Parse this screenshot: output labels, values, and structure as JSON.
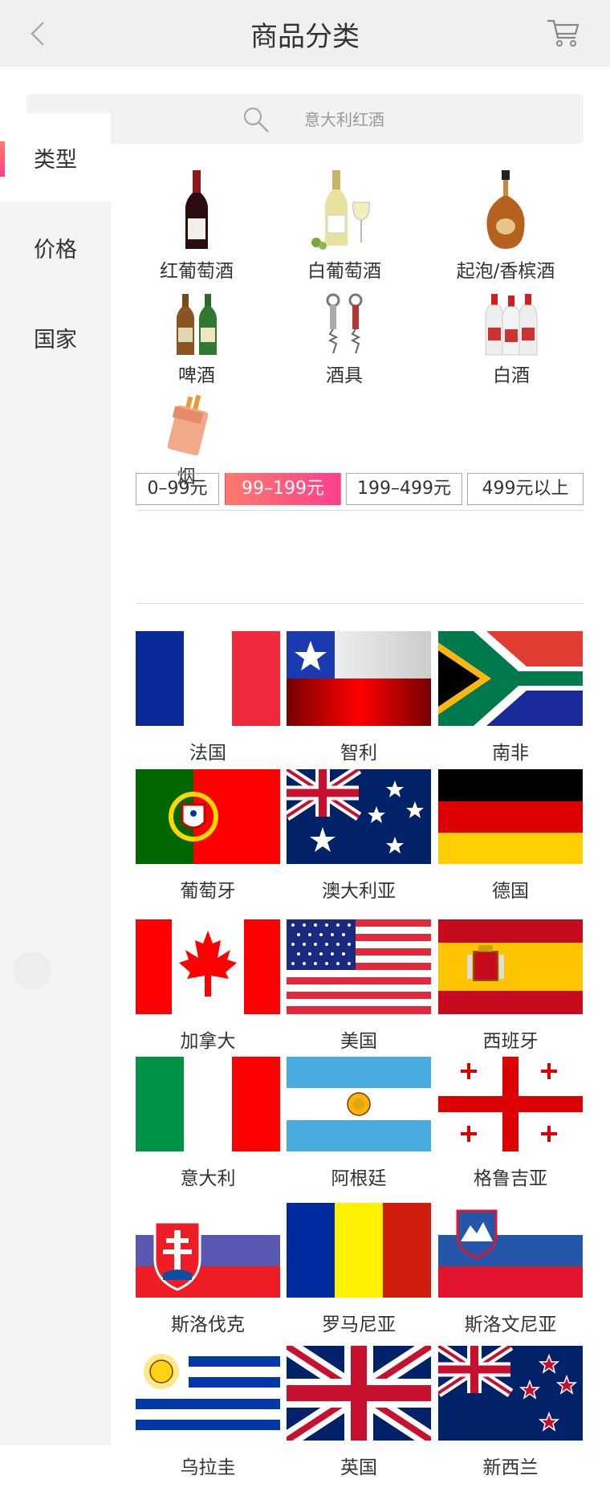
{
  "header": {
    "title": "商品分类"
  },
  "search": {
    "placeholder": "意大利红酒"
  },
  "sidebar": {
    "items": [
      {
        "label": "类型"
      },
      {
        "label": "价格"
      },
      {
        "label": "国家"
      }
    ]
  },
  "categories": [
    {
      "label": "红葡萄酒"
    },
    {
      "label": "白葡萄酒"
    },
    {
      "label": "起泡/香槟酒"
    },
    {
      "label": "啤酒"
    },
    {
      "label": "酒具"
    },
    {
      "label": "白酒"
    },
    {
      "label": "烟"
    }
  ],
  "prices": [
    {
      "label": "0–99元",
      "selected": false
    },
    {
      "label": "99–199元",
      "selected": true
    },
    {
      "label": "199–499元",
      "selected": false
    },
    {
      "label": "499元以上",
      "selected": false
    }
  ],
  "countries": [
    {
      "label": "法国"
    },
    {
      "label": "智利"
    },
    {
      "label": "南非"
    },
    {
      "label": "葡萄牙"
    },
    {
      "label": "澳大利亚"
    },
    {
      "label": "德国"
    },
    {
      "label": "加拿大"
    },
    {
      "label": "美国"
    },
    {
      "label": "西班牙"
    },
    {
      "label": "意大利"
    },
    {
      "label": "阿根廷"
    },
    {
      "label": "格鲁吉亚"
    },
    {
      "label": "斯洛伐克"
    },
    {
      "label": "罗马尼亚"
    },
    {
      "label": "斯洛文尼亚"
    },
    {
      "label": "乌拉圭"
    },
    {
      "label": "英国"
    },
    {
      "label": "新西兰"
    }
  ],
  "colors": {
    "accent_start": "#ff7a6a",
    "accent_end": "#ff3f8e"
  }
}
